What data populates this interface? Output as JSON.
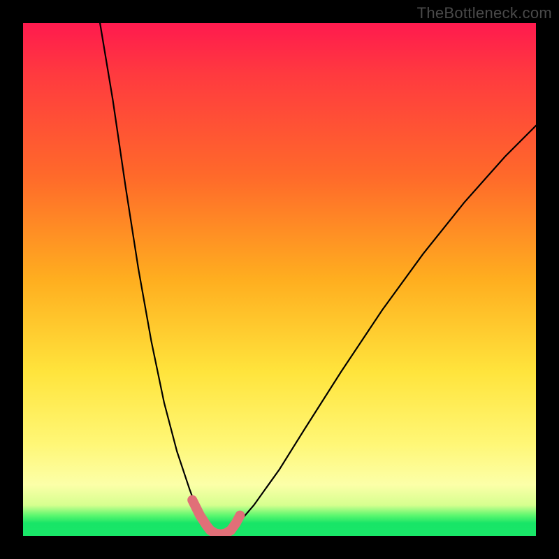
{
  "watermark": "TheBottleneck.com",
  "colors": {
    "background": "#000000",
    "gradient_top": "#ff1a4e",
    "gradient_mid1": "#ff6a2a",
    "gradient_mid2": "#ffe43c",
    "gradient_low": "#fcffa8",
    "gradient_bottom": "#18e567",
    "curve": "#000000",
    "thick_overlay": "#e16f78"
  },
  "chart_data": {
    "type": "line",
    "title": "",
    "xlabel": "",
    "ylabel": "",
    "x_range": [
      0,
      100
    ],
    "y_range": [
      0,
      100
    ],
    "description": "Bottleneck-style V-curve with a sharp minimum; left branch falls steeply, right branch rises more gradually.",
    "series": [
      {
        "name": "left_branch",
        "x": [
          15.0,
          17.5,
          20.0,
          22.5,
          25.0,
          27.5,
          30.0,
          32.5,
          34.0,
          35.5,
          36.5
        ],
        "y": [
          100.0,
          85.0,
          68.0,
          52.0,
          38.0,
          26.0,
          16.5,
          9.0,
          5.0,
          2.3,
          1.1
        ]
      },
      {
        "name": "right_branch",
        "x": [
          40.5,
          42.0,
          45.0,
          50.0,
          55.0,
          62.0,
          70.0,
          78.0,
          86.0,
          94.0,
          100.0
        ],
        "y": [
          1.1,
          2.5,
          6.0,
          13.0,
          21.0,
          32.0,
          44.0,
          55.0,
          65.0,
          74.0,
          80.0
        ]
      },
      {
        "name": "valley_floor",
        "x": [
          36.5,
          37.5,
          38.5,
          39.5,
          40.5
        ],
        "y": [
          1.1,
          0.5,
          0.3,
          0.5,
          1.1
        ]
      },
      {
        "name": "thick_overlay_left",
        "x": [
          33.0,
          34.5,
          35.8,
          36.5
        ],
        "y": [
          7.0,
          4.0,
          2.0,
          1.1
        ]
      },
      {
        "name": "thick_overlay_floor",
        "x": [
          36.5,
          37.5,
          38.5,
          39.5,
          40.5
        ],
        "y": [
          1.1,
          0.5,
          0.3,
          0.5,
          1.1
        ]
      },
      {
        "name": "thick_overlay_right",
        "x": [
          40.5,
          41.5,
          42.3
        ],
        "y": [
          1.1,
          2.5,
          4.0
        ]
      }
    ]
  }
}
